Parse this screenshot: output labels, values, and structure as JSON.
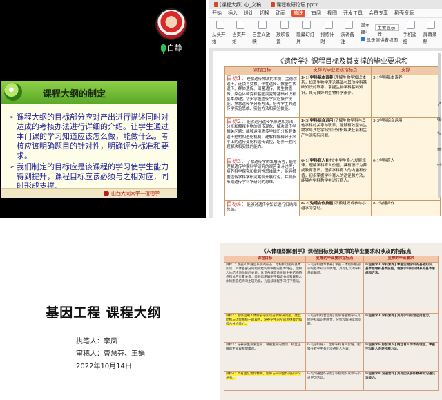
{
  "meeting": {
    "participant_name": "白静",
    "slide": {
      "title": "课程大纲的制定",
      "bullets": [
        "课程大纲的目标部分应对产出进行描述同时对达成的考核办法进行详细的介绍。让学生通过本门课的学习知道应该怎么做，能做什么。考核应该明确题目的针对性，明确评分标准和要求。",
        "我们制定的目标应是该课程的学习使学生能力得到提升，课程目标应该必须与之相对应，同时形成支撑。"
      ],
      "footer": "山西大同大学—植物学"
    }
  },
  "editor": {
    "tabs": [
      "[课程大纲] 心_文稿",
      "课程教研论坛.pptx"
    ],
    "menu": [
      "开始",
      "插入",
      "设计",
      "切换",
      "动画",
      "放映",
      "审阅",
      "视图",
      "开发工具",
      "会员专享",
      "稻壳资源"
    ],
    "active_menu": "放映",
    "toolbar": {
      "from_start": "从头开始",
      "from_current": "当页开始",
      "custom": "自定义放映",
      "setup": "放映设置",
      "hide": "隐藏幻灯片",
      "rehearse": "排练计时",
      "record": "演讲备注",
      "monitor_label": "显示器:",
      "monitor_value": "主要显示器",
      "show_presenter": "显示演讲者视图",
      "phone_remote": "手机遥控",
      "screen_record": "屏幕录制"
    },
    "side_tools": [
      "↗",
      "⊕",
      "✎",
      "≡",
      "⇨"
    ],
    "doc": {
      "title": "《遗传学》课程目标及其支撑的毕业要求和",
      "headers": [
        "课程目标",
        "支撑的毕业要求指标点",
        "支撑"
      ],
      "rows": [
        {
          "goal_lead": "目标1：",
          "goal": "理解遗传物质的本质、孟德尔遗传、连锁与交换、伴性遗传、数量性状遗传、群体遗传、细菌遗传、微生物遗传、染色体畸变和基因突变等基础知识和基本原理；初步掌握遗传学实验操作技能，熟悉遗传学分析方法，培养学生的遗传学实验思维、实验方法和实验技能。",
          "req_lead": "3-1[学科基本素养]",
          "req": "理解生物学知识体系，知道生物学理论基础与其他学科基础知识的联系，掌握生物学科基础知识，具有良好的生物科学素养。",
          "side": "3-1学科基本素养"
        },
        {
          "goal_lead": "目标2：",
          "goal": "能够运用遗传学原理和方法，分析和解释生物的遗传现象，解决遗传学相关问题；能够运用遗传学知识分析群体遗传结构和进化机制，理解和解释分子水平上的遗传变化和遗传调控，培养一般问题解决和实践的能力。",
          "req_lead": "3-3[学科综合运用]",
          "req": "了解生物学科与其他学科的关系与联系，能够有效整合生物学与其它学科知识分析解决社会和生产生活实际问题。",
          "side": "3-3学科综合运用"
        },
        {
          "goal_lead": "目标3：",
          "goal": "了解遗传学的发展历程，能够理解遗传学家科学研究的艰苦奋斗过程；培养科学探究和批判性思维能力，能够根据遗传学科学研究案例开展讨论，并初步形成遗传学科学研究的思维。",
          "req_lead": "6-1[学科育人]",
          "req": "树立中学生身心发展规律，理解学科育人价值，具有德行为养成教育意识，理解学科育人的内涵和价值，初步掌握学科育人的途径和方法，能够在学科教学中进行育人。",
          "side": "6-1学科育人"
        },
        {
          "goal_lead": "目标4：",
          "goal": "能够对遗传学知识进行归纳和总结。",
          "req_lead": "8-2[沟通合作技能]",
          "req": "积极组织或参与小组学习活动。",
          "side": "8-2沟通合作"
        }
      ]
    }
  },
  "cover": {
    "title": "基因工程 课程大纲",
    "author_label": "执笔人：",
    "author": "李凤",
    "reviewer_label": "审稿人：",
    "reviewers": "曹慧芬、王娟",
    "date": "2022年10月14日"
  },
  "doc2": {
    "title": "《人体组织解剖学》课程目标及其支撑的毕业要求和涉及的指标点",
    "headers": [
      "课程目标",
      "支撑的毕业要求指标点",
      "支撑的毕业要求"
    ],
    "rows": [
      {
        "goal": "目标1：掌握人体器官系统的形态、结构和功能的基本知识，人体各部分的组织结构和细胞的基本特征，理解人体结构与功能的关系；认识各器官系统的主要结构特点和体内位置关系；能够运用解剖学知识分析和解释人体的形态结构与生理功能，为后续课程学习打下基础。",
        "req": "3-1[学科基本素养] 掌握人体组织解剖学的基本知识和原理，具有扎实的学科基础知识。",
        "side": "毕业要求3[学科素养] 掌握生物学科的基础知识、基本原理和基本技能，理解学科知识体系的基本思想和方法。"
      },
      {
        "goal": "目标2：能够运用人体解剖学知识分析解决问题，建立结构与功能相统一的观点，培养学生的空间思维能力和综合分析能力。",
        "req": "3-3[学科综合运用] 能够将生物学与其他学科知识相整合，分析和解决实际问题。",
        "side": "毕业要求3[学科素养] 具有学科综合运用能力。"
      },
      {
        "goal": "目标3：培养学生热爱生命、尊重生命的意识，树立正确的生命观和健康观。",
        "req": "6-1[学科育人] 理解学科育人价值，能够在教学中有机渗透育人内容。",
        "side": "毕业要求6[综合育人] 树立育人为本的理念，掌握学科育人的途径和方法。"
      },
      {
        "goal": "目标4：具有团队协作精神，能够与同学合作完成学习任务。",
        "req": "8-2[沟通合作技能] 积极组织或参与小组学习活动。",
        "side": "毕业要求8[沟通合作] 具有团队协作精神和沟通交流能力。"
      }
    ]
  }
}
